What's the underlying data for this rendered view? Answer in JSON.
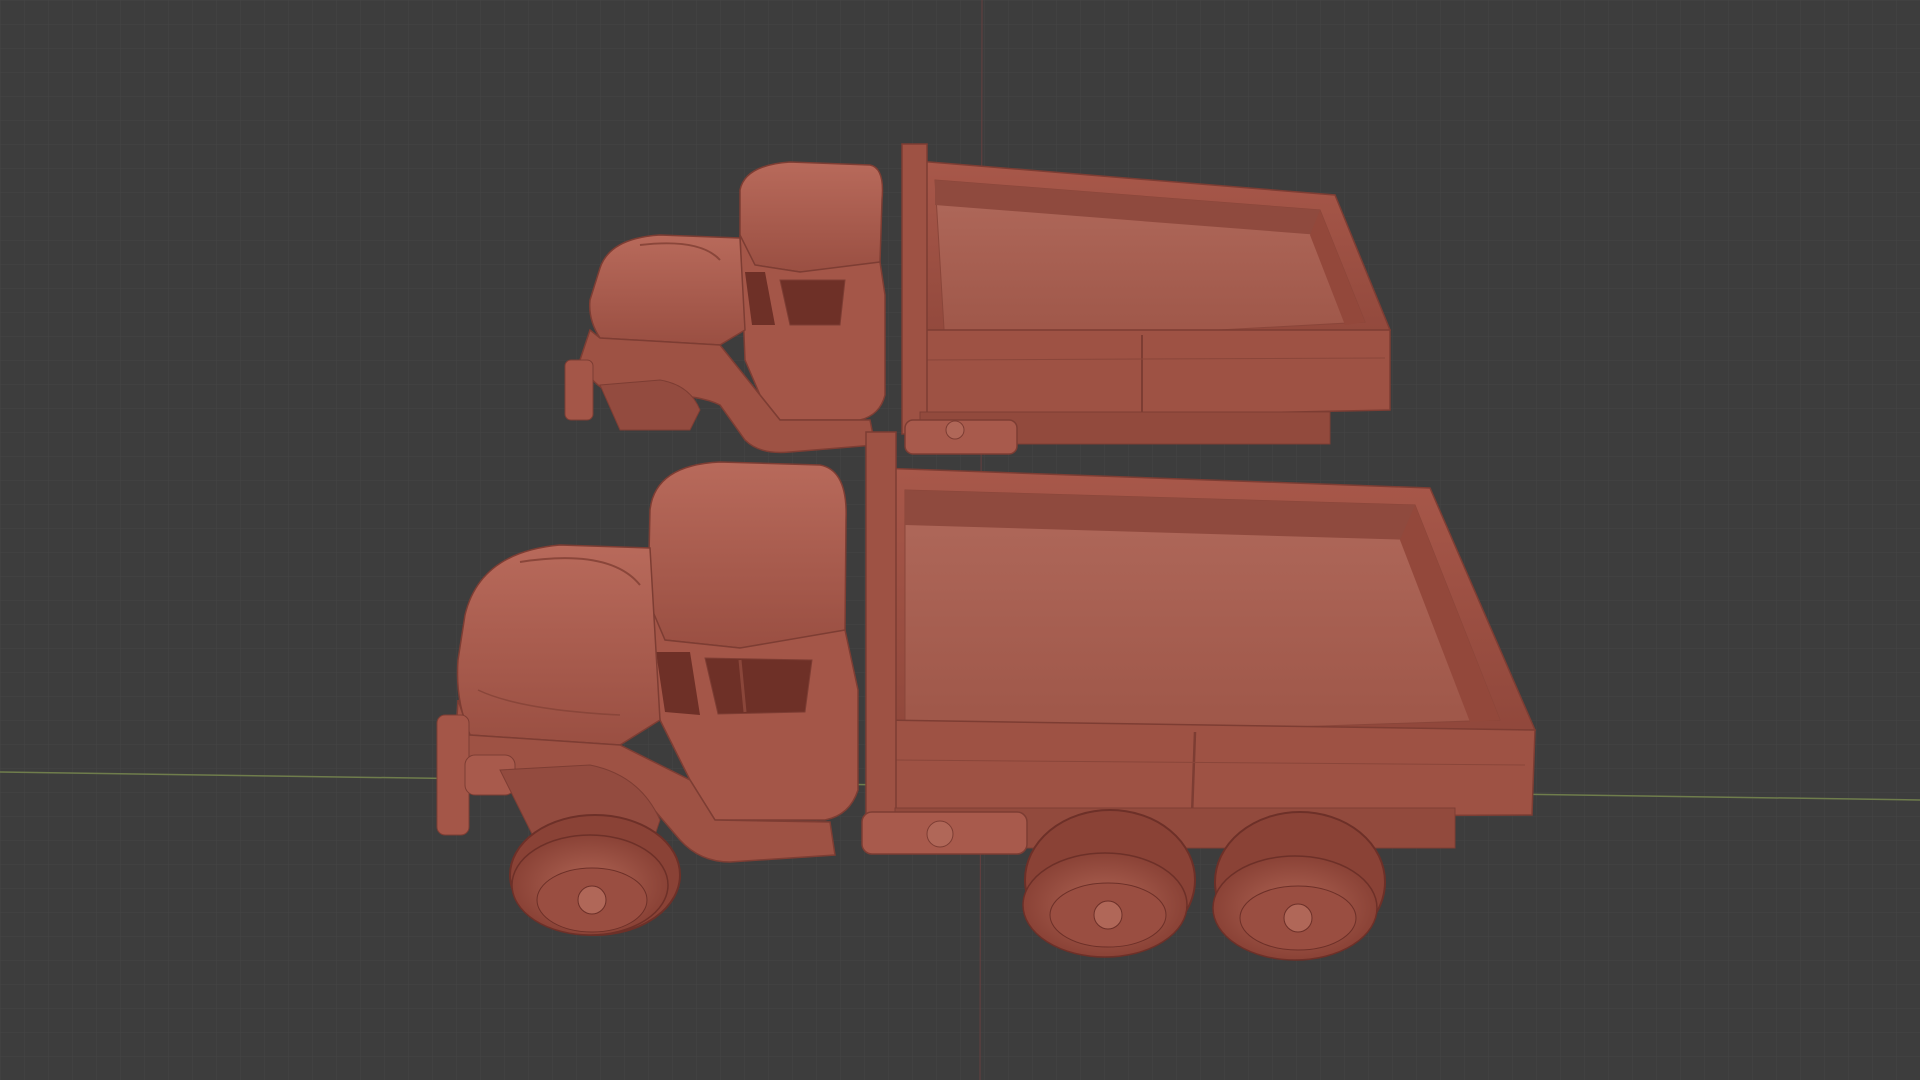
{
  "viewport": {
    "background": "#3d3d3d",
    "grid_color": "#474747",
    "x_axis_color": "#7a8a52",
    "y_axis_color": "#8a4a4a",
    "clay_color": "#a85a4c"
  },
  "scene": {
    "objects": [
      {
        "name": "truck-body-shell",
        "icon": "mesh-icon"
      },
      {
        "name": "truck-full-assembly",
        "icon": "mesh-icon"
      }
    ]
  }
}
